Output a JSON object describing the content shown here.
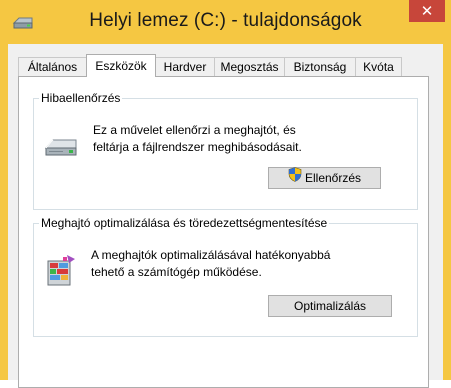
{
  "window": {
    "title": "Helyi lemez (C:) - tulajdonságok",
    "close_glyph": "✕",
    "icon": "drive-icon",
    "titlebar_color": "#f5c742",
    "close_color": "#c7463a"
  },
  "tabs": [
    {
      "label": "Általános",
      "active": false
    },
    {
      "label": "Eszközök",
      "active": true
    },
    {
      "label": "Hardver",
      "active": false
    },
    {
      "label": "Megosztás",
      "active": false
    },
    {
      "label": "Biztonság",
      "active": false
    },
    {
      "label": "Kvóta",
      "active": false
    }
  ],
  "error_check": {
    "title": "Hibaellenőrzés",
    "line1": "Ez a művelet ellenőrzi a meghajtót, és",
    "line2": "feltárja a fájlrendszer meghibásodásait.",
    "button_label": "Ellenőrzés",
    "icon": "hard-drive-icon",
    "button_icon": "uac-shield-icon"
  },
  "optimize": {
    "title": "Meghajtó optimalizálása és töredezettségmentesítése",
    "line1": "A meghajtók optimalizálásával hatékonyabbá",
    "line2": "tehető a számítógép működése.",
    "button_label": "Optimalizálás",
    "icon": "defrag-icon"
  }
}
